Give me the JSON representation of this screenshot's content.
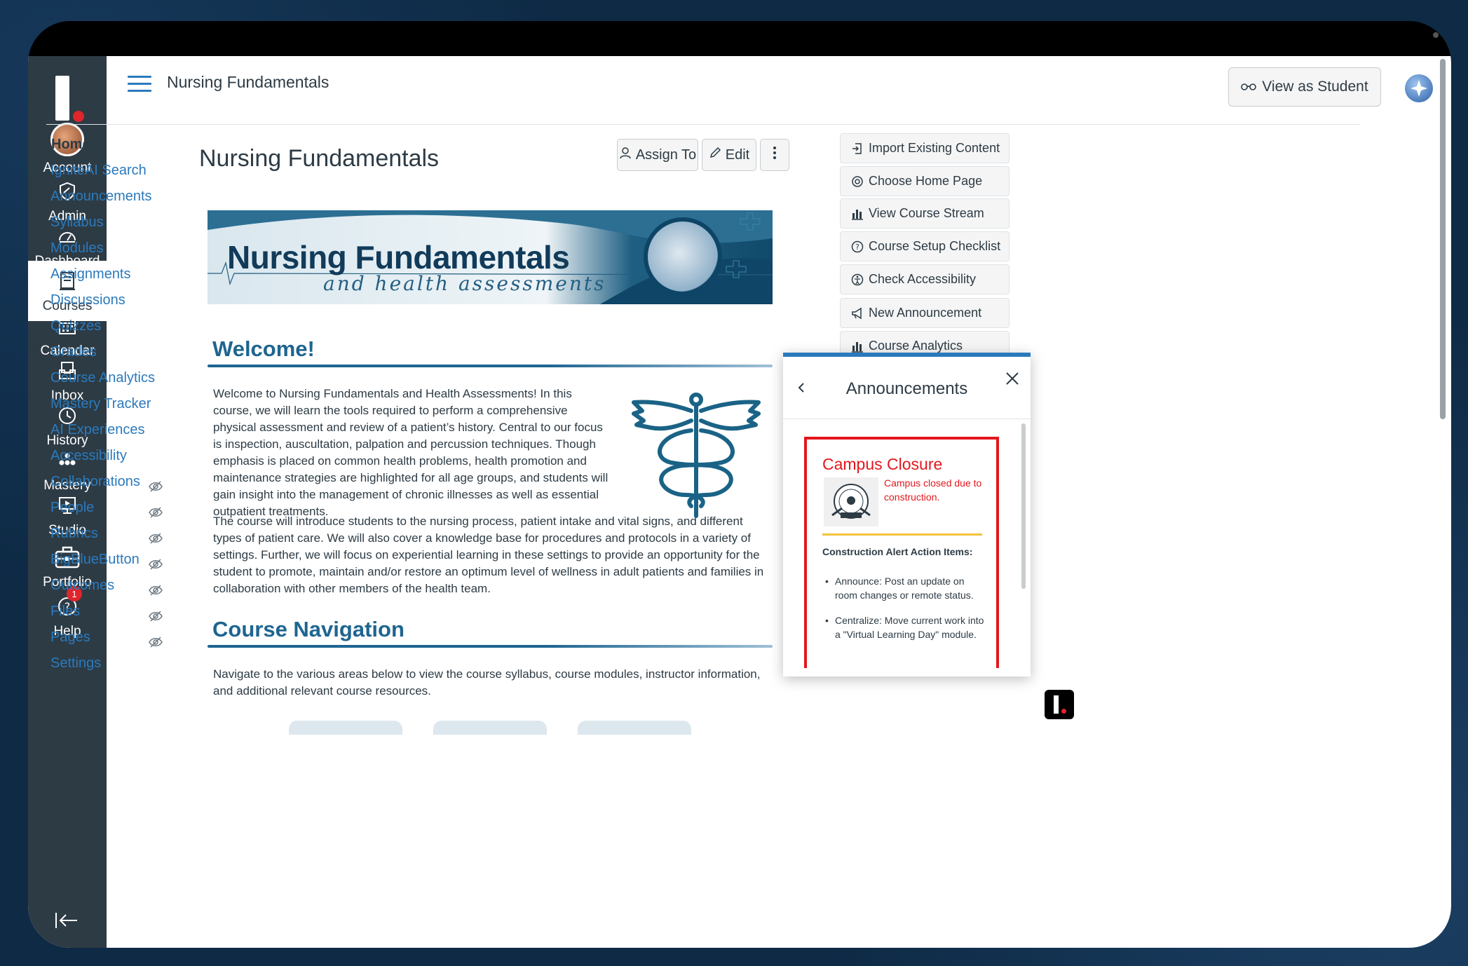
{
  "global_nav": {
    "items": [
      {
        "label": "Account",
        "icon": "avatar"
      },
      {
        "label": "Admin",
        "icon": "shield-icon"
      },
      {
        "label": "Dashboard",
        "icon": "dashboard-icon"
      },
      {
        "label": "Courses",
        "icon": "book-icon"
      },
      {
        "label": "Calendar",
        "icon": "calendar-icon"
      },
      {
        "label": "Inbox",
        "icon": "inbox-icon"
      },
      {
        "label": "History",
        "icon": "clock-icon"
      },
      {
        "label": "Mastery",
        "icon": "mastery-icon"
      },
      {
        "label": "Studio",
        "icon": "studio-icon"
      },
      {
        "label": "Portfolio",
        "icon": "briefcase-icon"
      },
      {
        "label": "Help",
        "icon": "help-icon",
        "badge": "1"
      }
    ],
    "active": "Courses"
  },
  "header": {
    "breadcrumb": "Nursing Fundamentals",
    "view_as_student": "View as Student"
  },
  "course_nav": {
    "items": [
      {
        "label": "Home",
        "active": true
      },
      {
        "label": "IgniteAI Search"
      },
      {
        "label": "Announcements"
      },
      {
        "label": "Syllabus"
      },
      {
        "label": "Modules"
      },
      {
        "label": "Assignments"
      },
      {
        "label": "Discussions"
      },
      {
        "label": "Quizzes"
      },
      {
        "label": "Grades"
      },
      {
        "label": "Course Analytics"
      },
      {
        "label": "Mastery Tracker"
      },
      {
        "label": "AI Experiences"
      },
      {
        "label": "Accessibility"
      },
      {
        "label": "Collaborations",
        "hidden": true
      },
      {
        "label": "People",
        "hidden": true
      },
      {
        "label": "Rubrics",
        "hidden": true
      },
      {
        "label": "BigBlueButton",
        "hidden": true
      },
      {
        "label": "Outcomes",
        "hidden": true
      },
      {
        "label": "Files",
        "hidden": true
      },
      {
        "label": "Pages",
        "hidden": true
      },
      {
        "label": "Settings"
      }
    ]
  },
  "main": {
    "title": "Nursing Fundamentals",
    "assign_to": "Assign To",
    "edit": "Edit",
    "banner": {
      "title": "Nursing Fundamentals",
      "subtitle": "and health assessments"
    },
    "welcome_heading": "Welcome!",
    "welcome_p1": "Welcome to Nursing Fundamentals and Health Assessments! In this course, we will learn the tools required to perform a comprehensive physical assessment and review of a patient’s history. Central to our focus is inspection, auscultation, palpation and percussion techniques. Though emphasis is placed on common health problems, health promotion and maintenance strategies are highlighted for all age groups, and students will gain insight into the management of chronic illnesses as well as essential outpatient treatments.",
    "welcome_p2": "The course will introduce students to the nursing process, patient intake and vital signs, and different types of patient care. We will also cover a knowledge base for procedures and protocols in a variety of settings. Further, we will focus on experiential learning in these settings to provide an opportunity for the student to promote, maintain and/or restore an optimum level of wellness in adult patients and families in collaboration with other members of the health team.",
    "nav_heading": "Course Navigation",
    "nav_p": "Navigate to the various areas below to view the course syllabus, course modules, instructor information, and additional relevant course resources."
  },
  "sidebar": {
    "buttons": [
      {
        "label": "Import Existing Content",
        "icon": "import-icon"
      },
      {
        "label": "Choose Home Page",
        "icon": "target-icon"
      },
      {
        "label": "View Course Stream",
        "icon": "bar-chart-icon"
      },
      {
        "label": "Course Setup Checklist",
        "icon": "question-icon"
      },
      {
        "label": "Check Accessibility",
        "icon": "accessibility-icon"
      },
      {
        "label": "New Announcement",
        "icon": "megaphone-icon"
      },
      {
        "label": "Course Analytics",
        "icon": "bar-chart-icon"
      }
    ]
  },
  "announcements": {
    "title": "Announcements",
    "card": {
      "heading": "Campus Closure",
      "red_text": "Campus closed due to construction.",
      "seal_text": "CANVAS IMPACT",
      "subheading": "Construction Alert Action Items:",
      "items": [
        "Announce: Post an update on room changes or remote status.",
        "Centralize: Move current work into a \"Virtual Learning Day\" module."
      ]
    }
  },
  "colors": {
    "nav_bg": "#2d3b45",
    "link": "#2b7abc",
    "heading_blue": "#1e6590",
    "alert_red": "#e3171d",
    "accent_yellow": "#f3c23d"
  }
}
